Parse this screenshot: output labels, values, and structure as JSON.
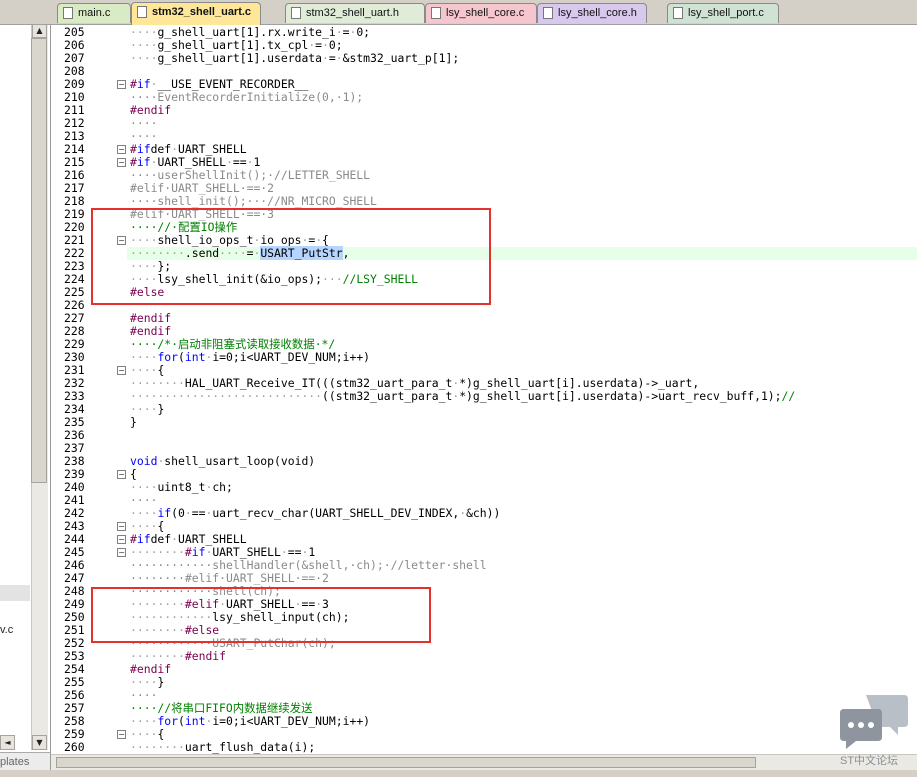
{
  "tabs": [
    {
      "label": "main.c",
      "bg": "#d9ebc4"
    },
    {
      "label": "stm32_shell_uart.c",
      "bg": "#ffe79a",
      "active": true
    },
    {
      "label": "stm32_shell_uart.h",
      "bg": "#e0ecd8"
    },
    {
      "label": "lsy_shell_core.c",
      "bg": "#f6c6cf"
    },
    {
      "label": "lsy_shell_core.h",
      "bg": "#d8c8ee"
    },
    {
      "label": "lsy_shell_port.c",
      "bg": "#cfe2d4"
    }
  ],
  "left_panel": {
    "pin": "ᛘ",
    "dropdown": "▼",
    "close": "x",
    "partial_file": "v.c",
    "partial_tab": "plates"
  },
  "scroll": {
    "up": "▲",
    "down": "▼",
    "left": "◄"
  },
  "colors": {
    "keyword": "#0000ff",
    "comment": "#008000",
    "preprocessor": "#7a0050",
    "inactive": "#8a8a8a",
    "annotation_box": "#e53030",
    "current_line": "#e6ffe6"
  },
  "lines": [
    {
      "n": "205",
      "code": "····g_shell_uart[1].rx.write_i·=·0;"
    },
    {
      "n": "206",
      "code": "····g_shell_uart[1].tx_cpl·=·0;"
    },
    {
      "n": "207",
      "code": "····g_shell_uart[1].userdata·=·&stm32_uart_p[1];"
    },
    {
      "n": "208",
      "code": ""
    },
    {
      "n": "209",
      "code": "#if·__USE_EVENT_RECORDER__",
      "fold": "−"
    },
    {
      "n": "210",
      "code": "····EventRecorderInitialize(0,·1);",
      "cls": "inactive"
    },
    {
      "n": "211",
      "code": "#endif"
    },
    {
      "n": "212",
      "code": "····",
      "cls": "inactive"
    },
    {
      "n": "213",
      "code": "····",
      "cls": "inactive"
    },
    {
      "n": "214",
      "code": "#ifdef·UART_SHELL",
      "fold": "−"
    },
    {
      "n": "215",
      "code": "#if·UART_SHELL·==·1",
      "fold": "−"
    },
    {
      "n": "216",
      "code": "····userShellInit();·//LETTER_SHELL",
      "cls": "inactive"
    },
    {
      "n": "217",
      "code": "#elif·UART_SHELL·==·2",
      "cls": "inactive"
    },
    {
      "n": "218",
      "code": "····shell_init();···//NR_MICRO_SHELL",
      "cls": "inactive"
    },
    {
      "n": "219",
      "code": "#elif·UART_SHELL·==·3",
      "cls": "inactive"
    },
    {
      "n": "220",
      "code": "····//·配置IO操作",
      "cls": "comment"
    },
    {
      "n": "221",
      "code": "····shell_io_ops_t·io_ops·=·{",
      "fold": "−"
    },
    {
      "n": "222",
      "code": "········.send····=·USART_PutStr,",
      "current": true
    },
    {
      "n": "223",
      "code": "····};"
    },
    {
      "n": "224",
      "code": "····lsy_shell_init(&io_ops);···//LSY_SHELL"
    },
    {
      "n": "225",
      "code": "#else"
    },
    {
      "n": "226",
      "code": ""
    },
    {
      "n": "227",
      "code": "#endif"
    },
    {
      "n": "228",
      "code": "#endif"
    },
    {
      "n": "229",
      "code": "····/*·启动非阻塞式读取接收数据·*/",
      "cls": "comment"
    },
    {
      "n": "230",
      "code": "····for(int·i=0;i<UART_DEV_NUM;i++)"
    },
    {
      "n": "231",
      "code": "····{",
      "fold": "−"
    },
    {
      "n": "232",
      "code": "········HAL_UART_Receive_IT(((stm32_uart_para_t·*)g_shell_uart[i].userdata)->_uart,"
    },
    {
      "n": "233",
      "code": "····························((stm32_uart_para_t·*)g_shell_uart[i].userdata)->uart_recv_buff,1);//"
    },
    {
      "n": "234",
      "code": "····}"
    },
    {
      "n": "235",
      "code": "}"
    },
    {
      "n": "236",
      "code": ""
    },
    {
      "n": "237",
      "code": ""
    },
    {
      "n": "238",
      "code": "void·shell_usart_loop(void)"
    },
    {
      "n": "239",
      "code": "{",
      "fold": "−"
    },
    {
      "n": "240",
      "code": "····uint8_t·ch;"
    },
    {
      "n": "241",
      "code": "····",
      "cls": "inactive"
    },
    {
      "n": "242",
      "code": "····if(0·==·uart_recv_char(UART_SHELL_DEV_INDEX,·&ch))"
    },
    {
      "n": "243",
      "code": "····{",
      "fold": "−"
    },
    {
      "n": "244",
      "code": "#ifdef·UART_SHELL",
      "fold": "−"
    },
    {
      "n": "245",
      "code": "········#if·UART_SHELL·==·1",
      "fold": "−"
    },
    {
      "n": "246",
      "code": "············shellHandler(&shell,·ch);·//letter·shell",
      "cls": "inactive"
    },
    {
      "n": "247",
      "code": "········#elif·UART_SHELL·==·2",
      "cls": "inactive"
    },
    {
      "n": "248",
      "code": "············shell(ch);",
      "cls": "inactive"
    },
    {
      "n": "249",
      "code": "········#elif·UART_SHELL·==·3"
    },
    {
      "n": "250",
      "code": "············lsy_shell_input(ch);"
    },
    {
      "n": "251",
      "code": "········#else"
    },
    {
      "n": "252",
      "code": "············USART_PutChar(ch);",
      "cls": "inactive"
    },
    {
      "n": "253",
      "code": "········#endif"
    },
    {
      "n": "254",
      "code": "#endif"
    },
    {
      "n": "255",
      "code": "····}"
    },
    {
      "n": "256",
      "code": "····",
      "cls": "inactive"
    },
    {
      "n": "257",
      "code": "····//将串口FIFO内数据继续发送",
      "cls": "comment"
    },
    {
      "n": "258",
      "code": "····for(int·i=0;i<UART_DEV_NUM;i++)"
    },
    {
      "n": "259",
      "code": "····{",
      "fold": "−"
    },
    {
      "n": "260",
      "code": "········uart_flush_data(i);"
    }
  ],
  "watermark": {
    "text": "ST中文论坛"
  }
}
